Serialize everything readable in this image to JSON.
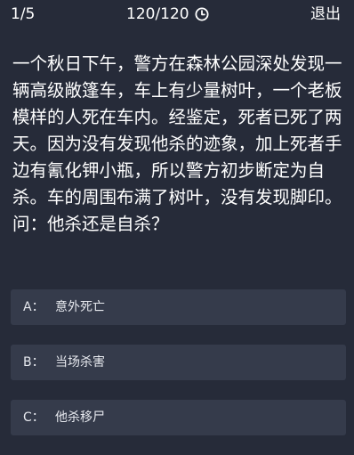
{
  "header": {
    "progress": "1/5",
    "timer": "120/120",
    "timer_icon": "clock-icon",
    "exit_label": "退出"
  },
  "question": {
    "text": "一个秋日下午，警方在森林公园深处发现一辆高级敞篷车，车上有少量树叶，一个老板模样的人死在车内。经鉴定，死者已死了两天。因为没有发现他杀的迹象，加上死者手边有氰化钾小瓶，所以警方初步断定为自杀。车的周围布满了树叶，没有发现脚印。问：他杀还是自杀？"
  },
  "options": [
    {
      "letter": "A：",
      "text": "意外死亡"
    },
    {
      "letter": "B：",
      "text": "当场杀害"
    },
    {
      "letter": "C：",
      "text": "他杀移尸"
    }
  ],
  "colors": {
    "background": "#262b39",
    "option_background": "#353b4b",
    "text": "#ffffff"
  }
}
